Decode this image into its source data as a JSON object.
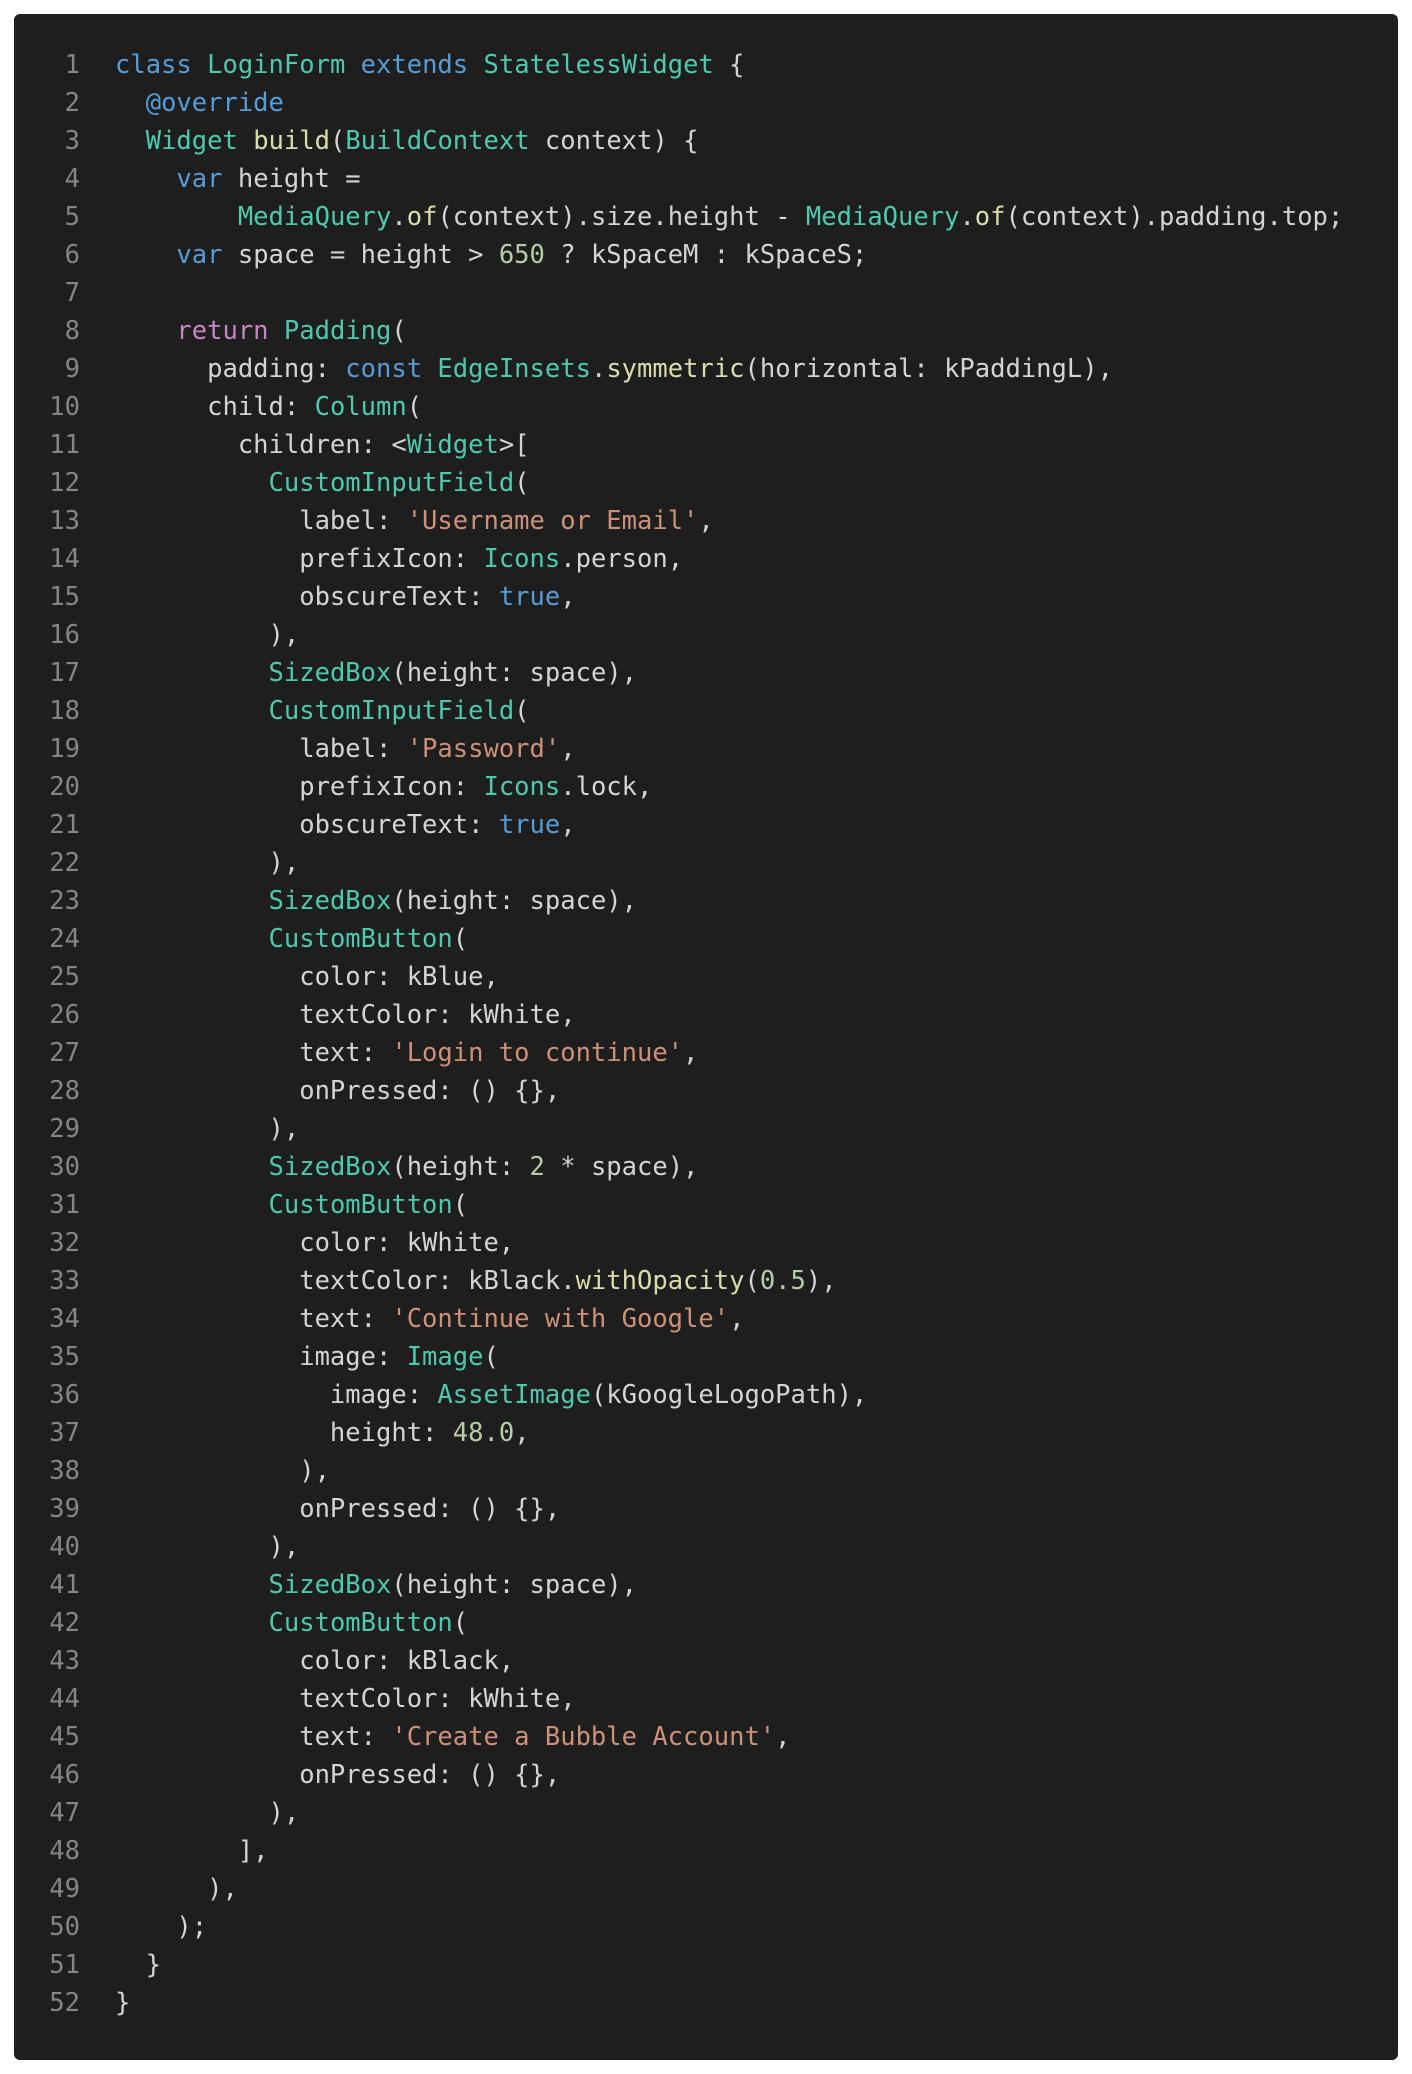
{
  "language": "Dart",
  "lines": [
    {
      "no": "1",
      "tokens": [
        [
          "keyword",
          "class"
        ],
        [
          "plain",
          " "
        ],
        [
          "type",
          "LoginForm"
        ],
        [
          "plain",
          " "
        ],
        [
          "keyword",
          "extends"
        ],
        [
          "plain",
          " "
        ],
        [
          "type",
          "StatelessWidget"
        ],
        [
          "plain",
          " {"
        ]
      ]
    },
    {
      "no": "2",
      "tokens": [
        [
          "plain",
          "  "
        ],
        [
          "keyword",
          "@override"
        ]
      ]
    },
    {
      "no": "3",
      "tokens": [
        [
          "plain",
          "  "
        ],
        [
          "type",
          "Widget"
        ],
        [
          "plain",
          " "
        ],
        [
          "func",
          "build"
        ],
        [
          "plain",
          "("
        ],
        [
          "type",
          "BuildContext"
        ],
        [
          "plain",
          " context) {"
        ]
      ]
    },
    {
      "no": "4",
      "tokens": [
        [
          "plain",
          "    "
        ],
        [
          "keyword",
          "var"
        ],
        [
          "plain",
          " height ="
        ]
      ]
    },
    {
      "no": "5",
      "tokens": [
        [
          "plain",
          "        "
        ],
        [
          "type",
          "MediaQuery"
        ],
        [
          "plain",
          "."
        ],
        [
          "func",
          "of"
        ],
        [
          "plain",
          "(context).size.height - "
        ],
        [
          "type",
          "MediaQuery"
        ],
        [
          "plain",
          "."
        ],
        [
          "func",
          "of"
        ],
        [
          "plain",
          "(context).padding.top;"
        ]
      ]
    },
    {
      "no": "6",
      "tokens": [
        [
          "plain",
          "    "
        ],
        [
          "keyword",
          "var"
        ],
        [
          "plain",
          " space = height > "
        ],
        [
          "number",
          "650"
        ],
        [
          "plain",
          " ? kSpaceM : kSpaceS;"
        ]
      ]
    },
    {
      "no": "7",
      "tokens": []
    },
    {
      "no": "8",
      "tokens": [
        [
          "plain",
          "    "
        ],
        [
          "control",
          "return"
        ],
        [
          "plain",
          " "
        ],
        [
          "type",
          "Padding"
        ],
        [
          "plain",
          "("
        ]
      ]
    },
    {
      "no": "9",
      "tokens": [
        [
          "plain",
          "      padding: "
        ],
        [
          "keyword",
          "const"
        ],
        [
          "plain",
          " "
        ],
        [
          "type",
          "EdgeInsets"
        ],
        [
          "plain",
          "."
        ],
        [
          "func",
          "symmetric"
        ],
        [
          "plain",
          "(horizontal: kPaddingL),"
        ]
      ]
    },
    {
      "no": "10",
      "tokens": [
        [
          "plain",
          "      child: "
        ],
        [
          "type",
          "Column"
        ],
        [
          "plain",
          "("
        ]
      ]
    },
    {
      "no": "11",
      "tokens": [
        [
          "plain",
          "        children: <"
        ],
        [
          "type",
          "Widget"
        ],
        [
          "plain",
          ">["
        ]
      ]
    },
    {
      "no": "12",
      "tokens": [
        [
          "plain",
          "          "
        ],
        [
          "type",
          "CustomInputField"
        ],
        [
          "plain",
          "("
        ]
      ]
    },
    {
      "no": "13",
      "tokens": [
        [
          "plain",
          "            label: "
        ],
        [
          "string",
          "'Username or Email'"
        ],
        [
          "plain",
          ","
        ]
      ]
    },
    {
      "no": "14",
      "tokens": [
        [
          "plain",
          "            prefixIcon: "
        ],
        [
          "type",
          "Icons"
        ],
        [
          "plain",
          ".person,"
        ]
      ]
    },
    {
      "no": "15",
      "tokens": [
        [
          "plain",
          "            obscureText: "
        ],
        [
          "keyword",
          "true"
        ],
        [
          "plain",
          ","
        ]
      ]
    },
    {
      "no": "16",
      "tokens": [
        [
          "plain",
          "          ),"
        ]
      ]
    },
    {
      "no": "17",
      "tokens": [
        [
          "plain",
          "          "
        ],
        [
          "type",
          "SizedBox"
        ],
        [
          "plain",
          "(height: space),"
        ]
      ]
    },
    {
      "no": "18",
      "tokens": [
        [
          "plain",
          "          "
        ],
        [
          "type",
          "CustomInputField"
        ],
        [
          "plain",
          "("
        ]
      ]
    },
    {
      "no": "19",
      "tokens": [
        [
          "plain",
          "            label: "
        ],
        [
          "string",
          "'Password'"
        ],
        [
          "plain",
          ","
        ]
      ]
    },
    {
      "no": "20",
      "tokens": [
        [
          "plain",
          "            prefixIcon: "
        ],
        [
          "type",
          "Icons"
        ],
        [
          "plain",
          ".lock,"
        ]
      ]
    },
    {
      "no": "21",
      "tokens": [
        [
          "plain",
          "            obscureText: "
        ],
        [
          "keyword",
          "true"
        ],
        [
          "plain",
          ","
        ]
      ]
    },
    {
      "no": "22",
      "tokens": [
        [
          "plain",
          "          ),"
        ]
      ]
    },
    {
      "no": "23",
      "tokens": [
        [
          "plain",
          "          "
        ],
        [
          "type",
          "SizedBox"
        ],
        [
          "plain",
          "(height: space),"
        ]
      ]
    },
    {
      "no": "24",
      "tokens": [
        [
          "plain",
          "          "
        ],
        [
          "type",
          "CustomButton"
        ],
        [
          "plain",
          "("
        ]
      ]
    },
    {
      "no": "25",
      "tokens": [
        [
          "plain",
          "            color: kBlue,"
        ]
      ]
    },
    {
      "no": "26",
      "tokens": [
        [
          "plain",
          "            textColor: kWhite,"
        ]
      ]
    },
    {
      "no": "27",
      "tokens": [
        [
          "plain",
          "            text: "
        ],
        [
          "string",
          "'Login to continue'"
        ],
        [
          "plain",
          ","
        ]
      ]
    },
    {
      "no": "28",
      "tokens": [
        [
          "plain",
          "            onPressed: () {},"
        ]
      ]
    },
    {
      "no": "29",
      "tokens": [
        [
          "plain",
          "          ),"
        ]
      ]
    },
    {
      "no": "30",
      "tokens": [
        [
          "plain",
          "          "
        ],
        [
          "type",
          "SizedBox"
        ],
        [
          "plain",
          "(height: "
        ],
        [
          "number",
          "2"
        ],
        [
          "plain",
          " * space),"
        ]
      ]
    },
    {
      "no": "31",
      "tokens": [
        [
          "plain",
          "          "
        ],
        [
          "type",
          "CustomButton"
        ],
        [
          "plain",
          "("
        ]
      ]
    },
    {
      "no": "32",
      "tokens": [
        [
          "plain",
          "            color: kWhite,"
        ]
      ]
    },
    {
      "no": "33",
      "tokens": [
        [
          "plain",
          "            textColor: kBlack."
        ],
        [
          "func",
          "withOpacity"
        ],
        [
          "plain",
          "("
        ],
        [
          "number",
          "0.5"
        ],
        [
          "plain",
          "),"
        ]
      ]
    },
    {
      "no": "34",
      "tokens": [
        [
          "plain",
          "            text: "
        ],
        [
          "string",
          "'Continue with Google'"
        ],
        [
          "plain",
          ","
        ]
      ]
    },
    {
      "no": "35",
      "tokens": [
        [
          "plain",
          "            image: "
        ],
        [
          "type",
          "Image"
        ],
        [
          "plain",
          "("
        ]
      ]
    },
    {
      "no": "36",
      "tokens": [
        [
          "plain",
          "              image: "
        ],
        [
          "type",
          "AssetImage"
        ],
        [
          "plain",
          "(kGoogleLogoPath),"
        ]
      ]
    },
    {
      "no": "37",
      "tokens": [
        [
          "plain",
          "              height: "
        ],
        [
          "number",
          "48.0"
        ],
        [
          "plain",
          ","
        ]
      ]
    },
    {
      "no": "38",
      "tokens": [
        [
          "plain",
          "            ),"
        ]
      ]
    },
    {
      "no": "39",
      "tokens": [
        [
          "plain",
          "            onPressed: () {},"
        ]
      ]
    },
    {
      "no": "40",
      "tokens": [
        [
          "plain",
          "          ),"
        ]
      ]
    },
    {
      "no": "41",
      "tokens": [
        [
          "plain",
          "          "
        ],
        [
          "type",
          "SizedBox"
        ],
        [
          "plain",
          "(height: space),"
        ]
      ]
    },
    {
      "no": "42",
      "tokens": [
        [
          "plain",
          "          "
        ],
        [
          "type",
          "CustomButton"
        ],
        [
          "plain",
          "("
        ]
      ]
    },
    {
      "no": "43",
      "tokens": [
        [
          "plain",
          "            color: kBlack,"
        ]
      ]
    },
    {
      "no": "44",
      "tokens": [
        [
          "plain",
          "            textColor: kWhite,"
        ]
      ]
    },
    {
      "no": "45",
      "tokens": [
        [
          "plain",
          "            text: "
        ],
        [
          "string",
          "'Create a Bubble Account'"
        ],
        [
          "plain",
          ","
        ]
      ]
    },
    {
      "no": "46",
      "tokens": [
        [
          "plain",
          "            onPressed: () {},"
        ]
      ]
    },
    {
      "no": "47",
      "tokens": [
        [
          "plain",
          "          ),"
        ]
      ]
    },
    {
      "no": "48",
      "tokens": [
        [
          "plain",
          "        ],"
        ]
      ]
    },
    {
      "no": "49",
      "tokens": [
        [
          "plain",
          "      ),"
        ]
      ]
    },
    {
      "no": "50",
      "tokens": [
        [
          "plain",
          "    );"
        ]
      ]
    },
    {
      "no": "51",
      "tokens": [
        [
          "plain",
          "  }"
        ]
      ]
    },
    {
      "no": "52",
      "tokens": [
        [
          "plain",
          "}"
        ]
      ]
    }
  ]
}
